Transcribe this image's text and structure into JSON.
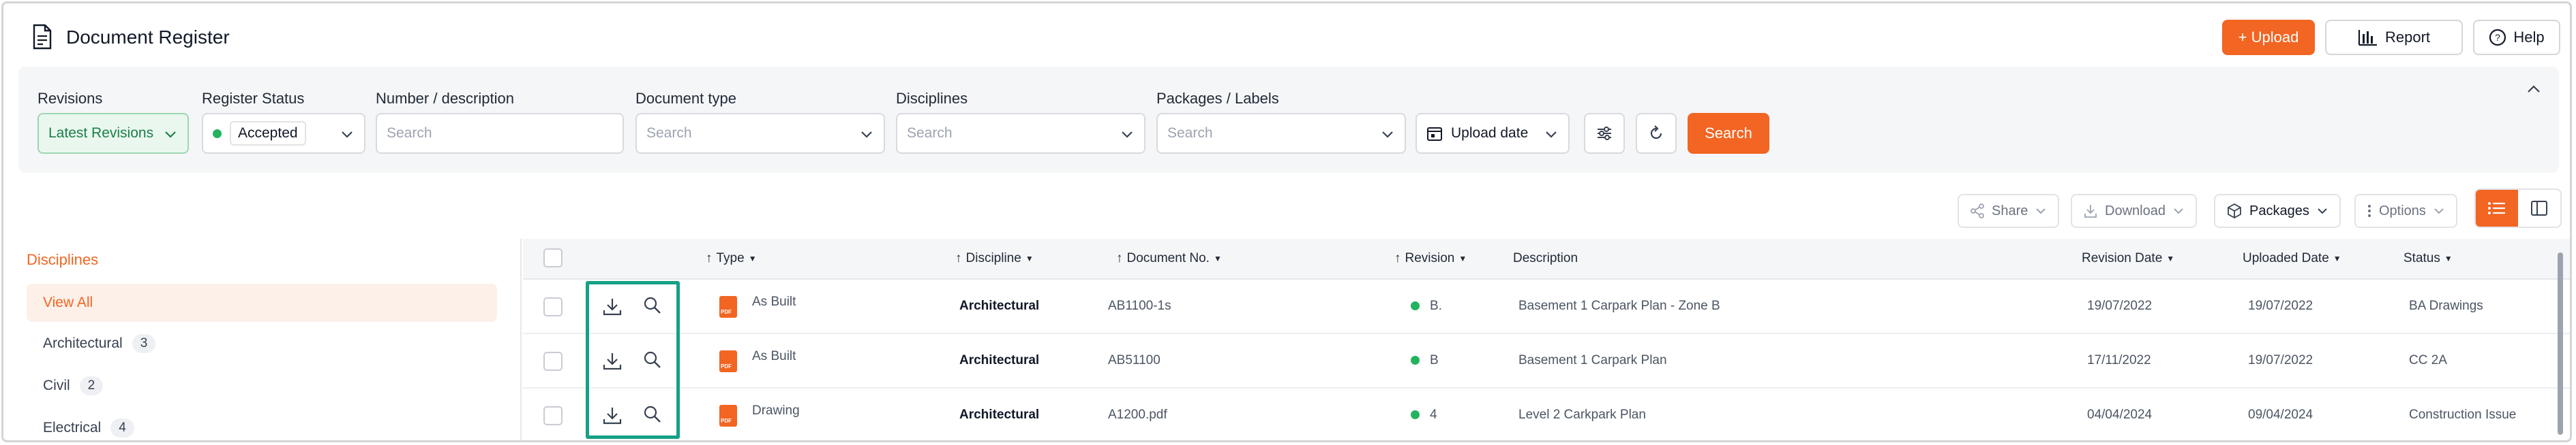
{
  "header": {
    "title": "Document Register",
    "upload_label": "+ Upload",
    "report_label": "Report",
    "help_label": "Help"
  },
  "filters": {
    "revisions": {
      "label": "Revisions",
      "value": "Latest Revisions"
    },
    "register_status": {
      "label": "Register Status",
      "value": "Accepted"
    },
    "number_description": {
      "label": "Number / description",
      "placeholder": "Search"
    },
    "document_type": {
      "label": "Document type",
      "placeholder": "Search"
    },
    "disciplines": {
      "label": "Disciplines",
      "placeholder": "Search"
    },
    "packages_labels": {
      "label": "Packages / Labels",
      "placeholder": "Search"
    },
    "upload_date": {
      "value": "Upload date"
    },
    "search_label": "Search"
  },
  "toolbar": {
    "share": "Share",
    "download": "Download",
    "packages": "Packages",
    "options": "Options"
  },
  "sidebar": {
    "heading": "Disciplines",
    "view_all": "View All",
    "items": [
      {
        "label": "Architectural",
        "count": "3"
      },
      {
        "label": "Civil",
        "count": "2"
      },
      {
        "label": "Electrical",
        "count": "4"
      }
    ]
  },
  "table": {
    "columns": {
      "type": "Type",
      "discipline": "Discipline",
      "document_no": "Document No.",
      "revision": "Revision",
      "description": "Description",
      "revision_date": "Revision Date",
      "uploaded_date": "Uploaded Date",
      "status": "Status"
    },
    "rows": [
      {
        "type": "As Built",
        "discipline": "Architectural",
        "document_no": "AB1100-1s",
        "revision": "B.",
        "description": "Basement 1 Carpark Plan - Zone B",
        "revision_date": "19/07/2022",
        "uploaded_date": "19/07/2022",
        "status": "BA Drawings"
      },
      {
        "type": "As Built",
        "discipline": "Architectural",
        "document_no": "AB51100",
        "revision": "B",
        "description": "Basement 1 Carpark Plan",
        "revision_date": "17/11/2022",
        "uploaded_date": "19/07/2022",
        "status": "CC 2A"
      },
      {
        "type": "Drawing",
        "discipline": "Architectural",
        "document_no": "A1200.pdf",
        "revision": "4",
        "description": "Level 2 Carkpark Plan",
        "revision_date": "04/04/2024",
        "uploaded_date": "09/04/2024",
        "status": "Construction Issue"
      }
    ]
  },
  "colors": {
    "accent": "#f26522",
    "success": "#22b35e",
    "highlight": "#16a085"
  }
}
